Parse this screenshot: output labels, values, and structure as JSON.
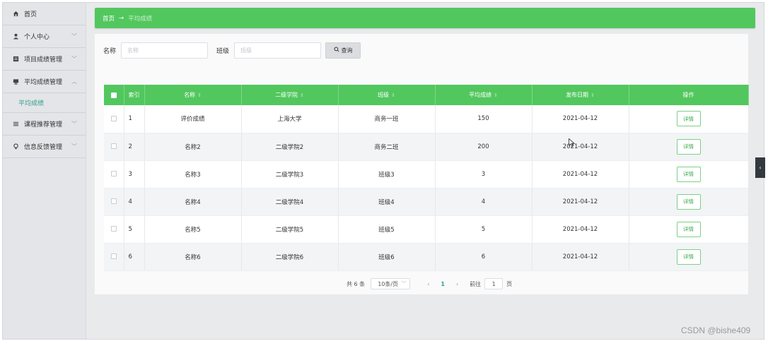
{
  "sidebar": {
    "items": [
      {
        "label": "首页",
        "icon": "home-icon"
      },
      {
        "label": "个人中心",
        "icon": "user-icon"
      },
      {
        "label": "项目成绩管理",
        "icon": "list-icon"
      },
      {
        "label": "平均成绩管理",
        "icon": "monitor-icon"
      },
      {
        "label": "课程推荐管理",
        "icon": "menu-icon"
      },
      {
        "label": "信息反馈管理",
        "icon": "bulb-icon"
      }
    ],
    "active_sub": "平均成绩"
  },
  "breadcrumb": {
    "home": "首页",
    "arrow": "→",
    "current": "平均成绩"
  },
  "search": {
    "name_label": "名称",
    "name_placeholder": "名称",
    "class_label": "班级",
    "class_placeholder": "班级",
    "button_label": "查询"
  },
  "table": {
    "headers": [
      "索引",
      "名称",
      "二级学院",
      "班级",
      "平均成绩",
      "发布日期",
      "操作"
    ],
    "rows": [
      {
        "index": "1",
        "name": "评价成绩",
        "college": "上海大学",
        "class": "商务一班",
        "score": "150",
        "date": "2021-04-12"
      },
      {
        "index": "2",
        "name": "名称2",
        "college": "二级学院2",
        "class": "商务二班",
        "score": "200",
        "date": "2021-04-12"
      },
      {
        "index": "3",
        "name": "名称3",
        "college": "二级学院3",
        "class": "班级3",
        "score": "3",
        "date": "2021-04-12"
      },
      {
        "index": "4",
        "name": "名称4",
        "college": "二级学院4",
        "class": "班级4",
        "score": "4",
        "date": "2021-04-12"
      },
      {
        "index": "5",
        "name": "名称5",
        "college": "二级学院5",
        "class": "班级5",
        "score": "5",
        "date": "2021-04-12"
      },
      {
        "index": "6",
        "name": "名称6",
        "college": "二级学院6",
        "class": "班级6",
        "score": "6",
        "date": "2021-04-12"
      }
    ],
    "detail_label": "详情"
  },
  "pagination": {
    "total": "共 6 条",
    "page_size": "10条/页",
    "current_page": "1",
    "goto_label": "前往",
    "goto_value": "1",
    "page_suffix": "页"
  },
  "watermark": "CSDN @bishe409",
  "colors": {
    "primary_green": "#52c75e",
    "link_teal": "#2f9e8f"
  }
}
